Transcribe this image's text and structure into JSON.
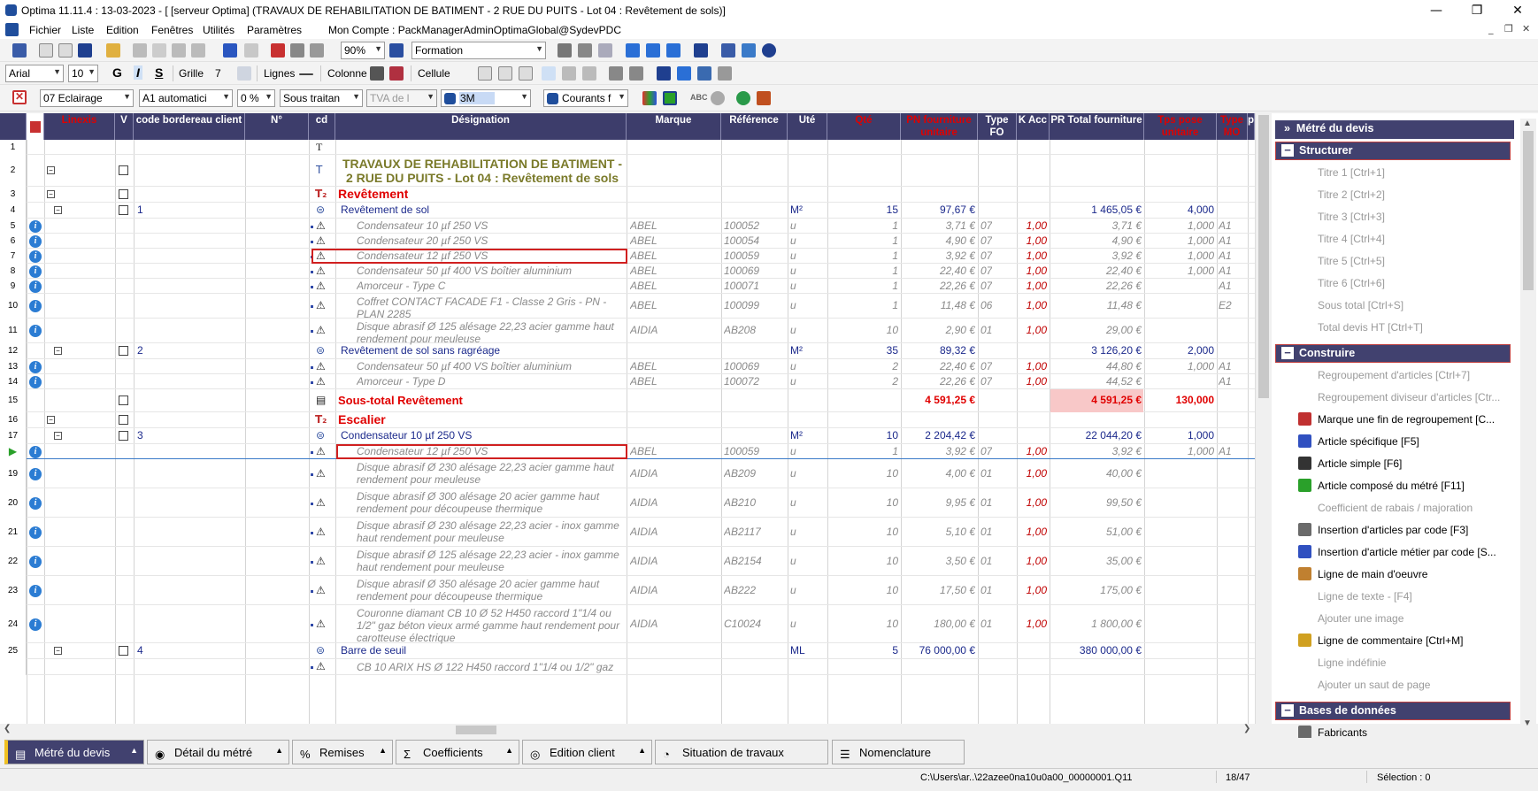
{
  "window": {
    "title": "Optima 11.11.4 : 13-03-2023 - [ [serveur Optima] (TRAVAUX DE REHABILITATION DE BATIMENT - 2 RUE DU PUITS - Lot 04 : Revêtement de sols)]",
    "minimize": "—",
    "maximize": "❐",
    "close": "✕"
  },
  "menu": {
    "items": [
      "Fichier",
      "Liste",
      "Edition",
      "Fenêtres",
      "Utilités",
      "Paramètres",
      "Mon Compte : PackManagerAdminOptimaGlobal@SydevPDC"
    ],
    "mdi": [
      "_",
      "❐",
      "✕"
    ]
  },
  "toolbar1": {
    "zoom": "90%",
    "view": "Formation"
  },
  "toolbar2": {
    "font": "Arial",
    "size": "10",
    "bold": "G",
    "italic": "I",
    "underline": "S",
    "grille": "Grille",
    "grille_val": "7",
    "lignes": "Lignes",
    "colonne": "Colonne",
    "cellule": "Cellule"
  },
  "toolbar3": {
    "lot": "07  Eclairage",
    "auto": "A1  automatici",
    "pct": "0 %",
    "sous": "Sous traitan",
    "tva": "TVA de l",
    "c3m": "3M",
    "courants": "Courants f",
    "abc": "ABC"
  },
  "grid": {
    "headers": [
      "",
      "Linexis",
      "V",
      "code bordereau client",
      "N°",
      "cd",
      "Désignation",
      "Marque",
      "Référence",
      "Uté",
      "Qté",
      "PN fourniture unitaire",
      "Type FO",
      "K Acc",
      "PR Total fourniture",
      "Tps pose unitaire",
      "Type MO",
      "p"
    ],
    "rows": [
      {
        "n": "1",
        "type": "text",
        "des": ""
      },
      {
        "n": "2",
        "type": "title",
        "des": "TRAVAUX DE REHABILITATION DE BATIMENT - 2 RUE DU PUITS  - Lot 04 : Revêtement de sols"
      },
      {
        "n": "3",
        "type": "t2",
        "des": "Revêtement"
      },
      {
        "n": "4",
        "type": "comp",
        "code": "1",
        "des": "Revêtement de sol",
        "ute": "M²",
        "qte": "15",
        "pn": "97,67 €",
        "prt": "1 465,05 €",
        "tps": "4,000"
      },
      {
        "n": "5",
        "type": "art",
        "des": "Condensateur 10 µf 250 VS",
        "marque": "ABEL",
        "ref": "100052",
        "ute": "u",
        "qte": "1",
        "pn": "3,71 €",
        "fo": "07",
        "k": "1,00",
        "prt": "3,71 €",
        "tps": "1,000",
        "mo": "A1"
      },
      {
        "n": "6",
        "type": "art",
        "des": "Condensateur 20 µf 250 VS",
        "marque": "ABEL",
        "ref": "100054",
        "ute": "u",
        "qte": "1",
        "pn": "4,90 €",
        "fo": "07",
        "k": "1,00",
        "prt": "4,90 €",
        "tps": "1,000",
        "mo": "A1"
      },
      {
        "n": "7",
        "type": "art",
        "des": "Condensateur 12 µf 250 VS",
        "marque": "ABEL",
        "ref": "100059",
        "ute": "u",
        "qte": "1",
        "pn": "3,92 €",
        "fo": "07",
        "k": "1,00",
        "prt": "3,92 €",
        "tps": "1,000",
        "mo": "A1"
      },
      {
        "n": "8",
        "type": "art",
        "des": "Condensateur 50 µf 400 VS boîtier aluminium",
        "marque": "ABEL",
        "ref": "100069",
        "ute": "u",
        "qte": "1",
        "pn": "22,40 €",
        "fo": "07",
        "k": "1,00",
        "prt": "22,40 €",
        "tps": "1,000",
        "mo": "A1"
      },
      {
        "n": "9",
        "type": "art",
        "des": "Amorceur  - Type C",
        "marque": "ABEL",
        "ref": "100071",
        "ute": "u",
        "qte": "1",
        "pn": "22,26 €",
        "fo": "07",
        "k": "1,00",
        "prt": "22,26 €",
        "tps": "",
        "mo": "A1"
      },
      {
        "n": "10",
        "type": "art",
        "des": "Coffret CONTACT FACADE F1 - Classe 2 Gris - PN - PLAN 2285",
        "marque": "ABEL",
        "ref": "100099",
        "ute": "u",
        "qte": "1",
        "pn": "11,48 €",
        "fo": "06",
        "k": "1,00",
        "prt": "11,48 €",
        "tps": "",
        "mo": "E2"
      },
      {
        "n": "11",
        "type": "art",
        "des": "Disque abrasif Ø 125 alésage 22,23 acier gamme haut rendement pour meuleuse",
        "marque": "AIDIA",
        "ref": "AB208",
        "ute": "u",
        "qte": "10",
        "pn": "2,90 €",
        "fo": "01",
        "k": "1,00",
        "prt": "29,00 €",
        "tps": "",
        "mo": ""
      },
      {
        "n": "12",
        "type": "comp",
        "code": "2",
        "des": "Revêtement de sol sans ragréage",
        "ute": "M²",
        "qte": "35",
        "pn": "89,32 €",
        "prt": "3 126,20 €",
        "tps": "2,000"
      },
      {
        "n": "13",
        "type": "art",
        "des": "Condensateur 50 µf 400 VS boîtier aluminium",
        "marque": "ABEL",
        "ref": "100069",
        "ute": "u",
        "qte": "2",
        "pn": "22,40 €",
        "fo": "07",
        "k": "1,00",
        "prt": "44,80 €",
        "tps": "1,000",
        "mo": "A1"
      },
      {
        "n": "14",
        "type": "art",
        "des": "Amorceur  - Type D",
        "marque": "ABEL",
        "ref": "100072",
        "ute": "u",
        "qte": "2",
        "pn": "22,26 €",
        "fo": "07",
        "k": "1,00",
        "prt": "44,52 €",
        "tps": "",
        "mo": "A1"
      },
      {
        "n": "15",
        "type": "sub",
        "des": "Sous-total Revêtement",
        "pn": "4 591,25 €",
        "prt": "4 591,25 €",
        "tps": "130,000"
      },
      {
        "n": "16",
        "type": "t2",
        "des": "Escalier"
      },
      {
        "n": "17",
        "type": "comp",
        "code": "3",
        "des": "Condensateur 10 µf 250 VS",
        "ute": "M²",
        "qte": "10",
        "pn": "2 204,42 €",
        "prt": "22 044,20 €",
        "tps": "1,000"
      },
      {
        "n": "",
        "type": "art",
        "des": "Condensateur 12 µf 250 VS",
        "marque": "ABEL",
        "ref": "100059",
        "ute": "u",
        "qte": "1",
        "pn": "3,92 €",
        "fo": "07",
        "k": "1,00",
        "prt": "3,92 €",
        "tps": "1,000",
        "mo": "A1"
      },
      {
        "n": "19",
        "type": "art",
        "des": "Disque abrasif Ø 230 alésage 22,23 acier gamme haut rendement pour meuleuse",
        "marque": "AIDIA",
        "ref": "AB209",
        "ute": "u",
        "qte": "10",
        "pn": "4,00 €",
        "fo": "01",
        "k": "1,00",
        "prt": "40,00 €",
        "tps": "",
        "mo": ""
      },
      {
        "n": "20",
        "type": "art",
        "des": "Disque abrasif Ø 300 alésage 20 acier gamme haut rendement pour découpeuse thermique",
        "marque": "AIDIA",
        "ref": "AB210",
        "ute": "u",
        "qte": "10",
        "pn": "9,95 €",
        "fo": "01",
        "k": "1,00",
        "prt": "99,50 €",
        "tps": "",
        "mo": ""
      },
      {
        "n": "21",
        "type": "art",
        "des": "Disque abrasif Ø 230 alésage 22,23 acier - inox gamme haut rendement pour meuleuse",
        "marque": "AIDIA",
        "ref": "AB2117",
        "ute": "u",
        "qte": "10",
        "pn": "5,10 €",
        "fo": "01",
        "k": "1,00",
        "prt": "51,00 €",
        "tps": "",
        "mo": ""
      },
      {
        "n": "22",
        "type": "art",
        "des": "Disque abrasif Ø 125 alésage 22,23 acier - inox gamme haut rendement pour meuleuse",
        "marque": "AIDIA",
        "ref": "AB2154",
        "ute": "u",
        "qte": "10",
        "pn": "3,50 €",
        "fo": "01",
        "k": "1,00",
        "prt": "35,00 €",
        "tps": "",
        "mo": ""
      },
      {
        "n": "23",
        "type": "art",
        "des": "Disque abrasif Ø 350 alésage 20 acier gamme haut rendement pour découpeuse thermique",
        "marque": "AIDIA",
        "ref": "AB222",
        "ute": "u",
        "qte": "10",
        "pn": "17,50 €",
        "fo": "01",
        "k": "1,00",
        "prt": "175,00 €",
        "tps": "",
        "mo": ""
      },
      {
        "n": "24",
        "type": "art",
        "des": "Couronne diamant CB 10 Ø 52 H450 raccord 1\"1/4 ou 1/2\" gaz béton vieux armé gamme haut rendement pour carotteuse électrique",
        "marque": "AIDIA",
        "ref": "C10024",
        "ute": "u",
        "qte": "10",
        "pn": "180,00 €",
        "fo": "01",
        "k": "1,00",
        "prt": "1 800,00 €",
        "tps": "",
        "mo": ""
      },
      {
        "n": "25",
        "type": "comp",
        "code": "4",
        "des": "Barre de seuil",
        "ute": "ML",
        "qte": "5",
        "pn": "76 000,00 €",
        "prt": "380 000,00 €",
        "tps": ""
      },
      {
        "n": "",
        "type": "art",
        "des": "CB 10 ARIX HS Ø 122 H450 raccord 1\"1/4 ou 1/2\" gaz",
        "marque": "",
        "ref": "",
        "ute": "",
        "qte": "",
        "pn": "",
        "fo": "",
        "k": "",
        "prt": "",
        "tps": "",
        "mo": ""
      }
    ]
  },
  "panel": {
    "header": "Métré du devis",
    "sections": [
      {
        "title": "Structurer",
        "items": [
          {
            "label": "Titre 1 [Ctrl+1]",
            "dis": true
          },
          {
            "label": "Titre 2 [Ctrl+2]",
            "dis": true
          },
          {
            "label": "Titre 3 [Ctrl+3]",
            "dis": true
          },
          {
            "label": "Titre 4 [Ctrl+4]",
            "dis": true
          },
          {
            "label": "Titre 5 [Ctrl+5]",
            "dis": true
          },
          {
            "label": "Titre 6 [Ctrl+6]",
            "dis": true
          },
          {
            "label": "Sous total [Ctrl+S]",
            "dis": true
          },
          {
            "label": "Total devis HT [Ctrl+T]",
            "dis": true
          }
        ]
      },
      {
        "title": "Construire",
        "items": [
          {
            "label": "Regroupement d'articles  [Ctrl+7]",
            "dis": true
          },
          {
            "label": "Regroupement diviseur d'articles [Ctr...",
            "dis": true
          },
          {
            "label": "Marque une fin de regroupement  [C...",
            "dis": false,
            "icon": "#c03030"
          },
          {
            "label": "Article spécifique [F5]",
            "dis": false,
            "icon": "#3050c0"
          },
          {
            "label": "Article simple [F6]",
            "dis": false,
            "icon": "#333333"
          },
          {
            "label": "Article composé du métré [F11]",
            "dis": false,
            "icon": "#2aa02a"
          },
          {
            "label": "Coefficient de rabais / majoration",
            "dis": true
          },
          {
            "label": "Insertion d'articles par code [F3]",
            "dis": false,
            "icon": "#6a6a6a"
          },
          {
            "label": "Insertion d'article métier par code [S...",
            "dis": false,
            "icon": "#3050c0"
          },
          {
            "label": "Ligne de main d'oeuvre",
            "dis": false,
            "icon": "#c08030"
          },
          {
            "label": "Ligne de texte - [F4]",
            "dis": true
          },
          {
            "label": "Ajouter une image",
            "dis": true
          },
          {
            "label": "Ligne de commentaire [Ctrl+M]",
            "dis": false,
            "icon": "#d0a020"
          },
          {
            "label": "Ligne indéfinie",
            "dis": true
          },
          {
            "label": "Ajouter un saut de page",
            "dis": true
          }
        ]
      },
      {
        "title": "Bases de données",
        "items": [
          {
            "label": "Fabricants",
            "dis": false,
            "icon": "#6a6a6a"
          }
        ]
      }
    ]
  },
  "tabs": [
    {
      "label": "Métré du devis",
      "active": true
    },
    {
      "label": "Détail du métré"
    },
    {
      "label": "Remises"
    },
    {
      "label": "Coefficients"
    },
    {
      "label": "Edition client"
    },
    {
      "label": "Situation de travaux"
    },
    {
      "label": "Nomenclature"
    }
  ],
  "status": {
    "path": "C:\\Users\\ar..\\22azee0na10u0a00_00000001.Q11",
    "pos": "18/47",
    "selection": "Sélection : 0"
  },
  "colors": {
    "header": "#3d3d6b",
    "title": "#7a7a2a",
    "red": "#e00000",
    "blue": "#1c2a8c",
    "subtotal_bg": "#f8c8c8"
  }
}
